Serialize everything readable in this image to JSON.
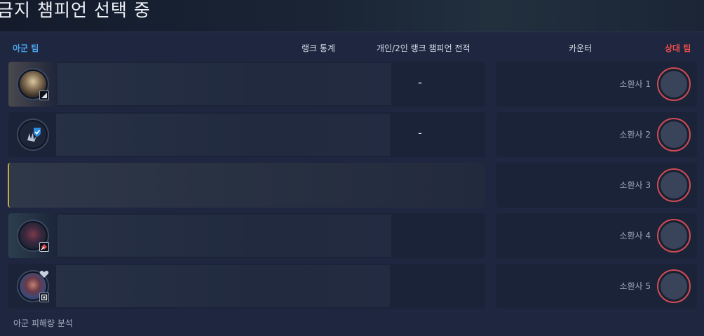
{
  "window": {
    "title": "금지 챔피언 선택 중"
  },
  "headers": {
    "ally_team": "아군 팀",
    "rank_stats": "랭크 통계",
    "solo_duo": "개인/2인 랭크 챔피언 전적",
    "counter": "카운터",
    "enemy_team": "상대 팀"
  },
  "ally_slots": [
    {
      "champion_icon": "armored-champion-portrait",
      "role_icon": "lane-role-icon",
      "rank_value": "-"
    },
    {
      "champion_icon": "shield-check-placeholder-icon",
      "role_icon": "",
      "rank_value": "-"
    },
    {
      "champion_icon": "",
      "role_icon": "",
      "rank_value": ""
    },
    {
      "champion_icon": "dark-champion-portrait",
      "role_icon": "lane-role-icon",
      "rank_value": ""
    },
    {
      "champion_icon": "swordsman-champion-portrait",
      "role_icon": "lane-role-icon",
      "rank_value": ""
    }
  ],
  "enemy_slots": [
    {
      "label": "소환사 1"
    },
    {
      "label": "소환사 2"
    },
    {
      "label": "소환사 3"
    },
    {
      "label": "소환사 4"
    },
    {
      "label": "소환사 5"
    }
  ],
  "footer": {
    "damage_analysis": "아군 피해량 분석"
  },
  "colors": {
    "ally_accent": "#4ba3e8",
    "enemy_accent": "#e84a4a",
    "active_border": "#c8a84a"
  }
}
